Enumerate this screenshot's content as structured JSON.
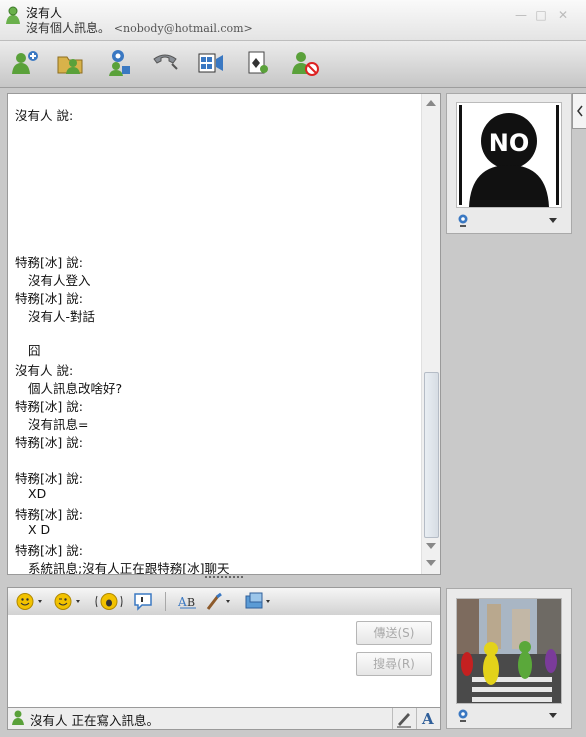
{
  "window": {
    "contact_name": "沒有人",
    "personal_message": "沒有個人訊息。",
    "email": "<nobody@hotmail.com>"
  },
  "toolbar": {
    "buttons": [
      "invite-contact",
      "send-files",
      "video-call",
      "voice-call",
      "activities",
      "games",
      "block-contact"
    ]
  },
  "history": {
    "lines": [
      {
        "kind": "speaker",
        "text": "沒有人 說:"
      },
      {
        "kind": "speaker",
        "text": "特務[冰] 說:"
      },
      {
        "kind": "msg",
        "text": "沒有人登入"
      },
      {
        "kind": "speaker",
        "text": "特務[冰] 說:"
      },
      {
        "kind": "msg",
        "text": "沒有人-對話"
      },
      {
        "kind": "msg",
        "text": "囧"
      },
      {
        "kind": "speaker",
        "text": "沒有人 說:"
      },
      {
        "kind": "msg",
        "text": "個人訊息改啥好?"
      },
      {
        "kind": "speaker",
        "text": "特務[冰] 說:"
      },
      {
        "kind": "msg",
        "text": "沒有訊息="
      },
      {
        "kind": "speaker",
        "text": "特務[冰] 說:"
      },
      {
        "kind": "speaker",
        "text": "特務[冰] 說:"
      },
      {
        "kind": "msg",
        "text": "XD"
      },
      {
        "kind": "speaker",
        "text": "特務[冰] 說:"
      },
      {
        "kind": "msg",
        "text": "X D"
      },
      {
        "kind": "speaker",
        "text": "特務[冰] 說:"
      },
      {
        "kind": "msg",
        "text": "系統訊息;沒有人正在跟特務[冰]聊天"
      }
    ]
  },
  "compose": {
    "send_label": "傳送(S)",
    "search_label": "搜尋(R)",
    "status_text": "沒有人 正在寫入訊息。"
  },
  "contact_picture": {
    "text": "NO"
  },
  "colors": {
    "accent_green": "#5aa13a",
    "toolbar_blue": "#3a78c2"
  }
}
